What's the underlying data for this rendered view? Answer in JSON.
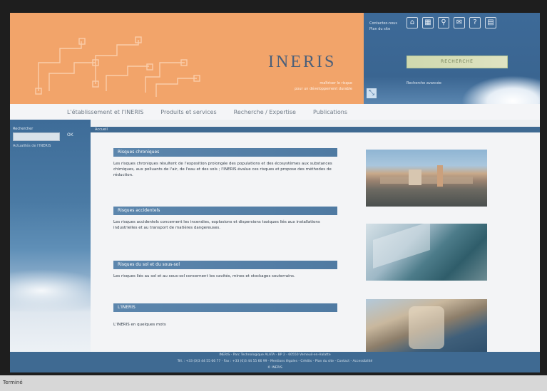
{
  "header": {
    "logo_text": "INERIS",
    "logo_sub1": "maîtriser le risque",
    "logo_sub2": "pour un développement durable",
    "lang_line1": "Contactez-nous",
    "lang_line2": "Plan du site",
    "icons": [
      "home-icon",
      "sitemap-icon",
      "search-icon",
      "mail-icon",
      "help-icon",
      "print-icon"
    ],
    "search_placeholder": "RECHERCHE",
    "advanced_search": "Recherche avancée"
  },
  "nav": {
    "items": [
      "L'établissement et l'INERIS",
      "Produits et services",
      "Recherche / Expertise",
      "Publications"
    ]
  },
  "sidebar": {
    "label": "Rechercher",
    "ok_label": "OK",
    "line": "Actualités de l'INERIS"
  },
  "breadcrumb": "Accueil",
  "sections": [
    {
      "title": "Risques chroniques",
      "text": "Les risques chroniques résultent de l'exposition prolongée des populations et des écosystèmes aux substances chimiques, aux polluants de l'air, de l'eau et des sols ; l'INERIS évalue ces risques et propose des méthodes de réduction."
    },
    {
      "title": "Risques accidentels",
      "text": "Les risques accidentels concernent les incendies, explosions et dispersions toxiques liés aux installations industrielles et au transport de matières dangereuses."
    },
    {
      "title": "Risques du sol et du sous-sol",
      "text": "Les risques liés au sol et au sous-sol concernent les cavités, mines et stockages souterrains."
    },
    {
      "title": "L'INERIS",
      "text": "L'INERIS en quelques mots"
    }
  ],
  "footer": {
    "line1": "INERIS - Parc Technologique ALATA - BP 2 - 60550 Verneuil-en-Halatte",
    "line2": "Tél. : +33 (0)3 44 55 66 77 - Fax : +33 (0)3 44 55 66 99 - Mentions légales - Crédits - Plan du site - Contact - Accessibilité",
    "line3": "© INERIS"
  },
  "status": "Terminé"
}
